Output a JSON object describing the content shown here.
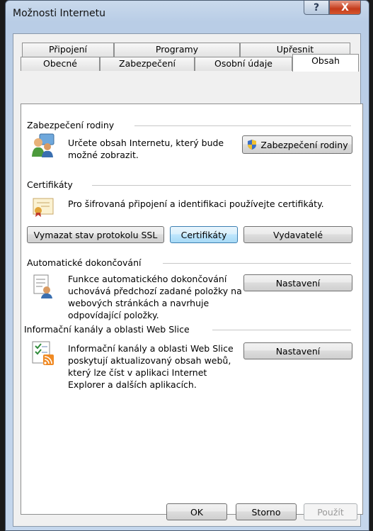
{
  "window": {
    "title": "Možnosti Internetu",
    "help_glyph": "?",
    "close_glyph": "X"
  },
  "tabs_row1": [
    "Připojení",
    "Programy",
    "Upřesnit"
  ],
  "tabs_row2": [
    "Obecné",
    "Zabezpečení",
    "Osobní údaje",
    "Obsah"
  ],
  "family": {
    "header": "Zabezpečení rodiny",
    "text": [
      "Určete obsah Internetu, který bude",
      "možné zobrazit."
    ],
    "button": "Zabezpečení rodiny"
  },
  "certificates": {
    "header": "Certifikáty",
    "text": "Pro šifrovaná připojení a identifikaci používejte certifikáty.",
    "buttons": [
      "Vymazat stav protokolu SSL",
      "Certifikáty",
      "Vydavatelé"
    ]
  },
  "autocomplete": {
    "header": "Automatické dokončování",
    "text": [
      "Funkce automatického dokončování",
      "uchovává předchozí zadané položky na",
      "webových stránkách a navrhuje",
      "odpovídající položky."
    ],
    "button": "Nastavení"
  },
  "feeds": {
    "header": "Informační kanály a oblasti Web Slice",
    "text": [
      "Informační kanály a oblasti Web Slice",
      "poskytují aktualizovaný obsah webů,",
      "který lze číst v aplikaci Internet",
      "Explorer a dalších aplikacích."
    ],
    "button": "Nastavení"
  },
  "footer": {
    "ok": "OK",
    "cancel": "Storno",
    "apply": "Použít"
  }
}
